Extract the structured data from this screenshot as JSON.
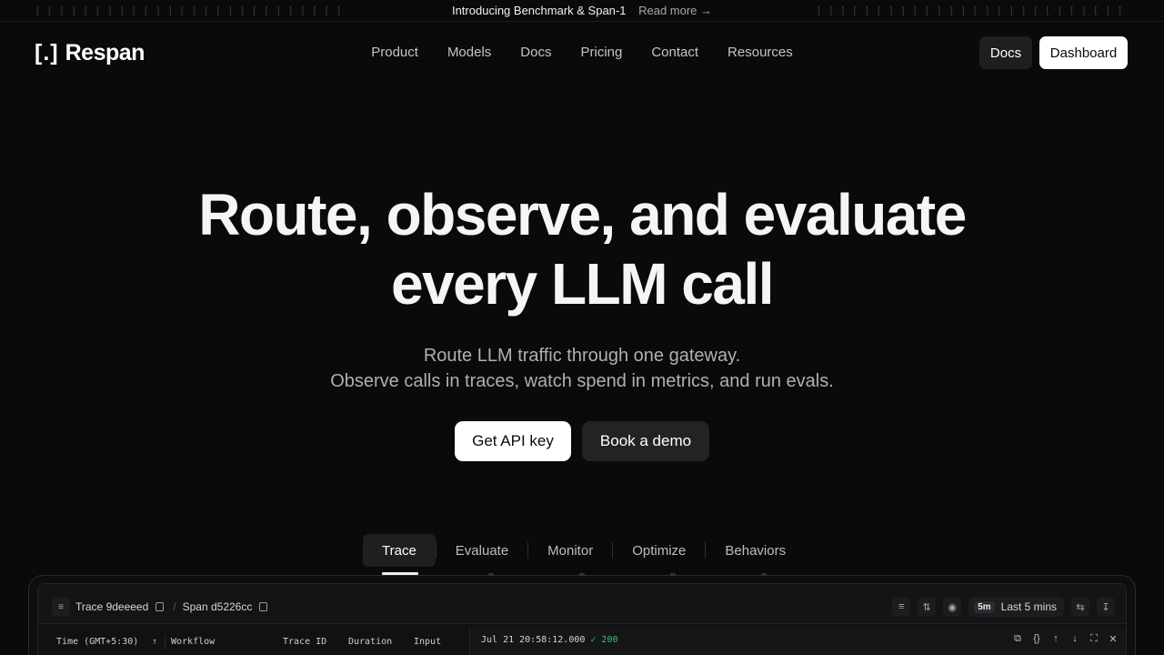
{
  "announcement": {
    "text": "Introducing Benchmark & Span-1",
    "link": "Read more →",
    "left_strip": "[ [ ] ] [ [ ] ] [ [ ] ] [ ] [ [ ] ] [ [ ] ] ] [ [ ] ] ] [ ] [ ] [ [ ] ] [ ] [ [ ] ] [ ] [ [",
    "right_strip": "] ] ] [ ] [ ] ] [ [ ] ] ] [ ] [ ] ] [ [ ] [ ] [ ] ] ] ] [ [ [ ] [ [ [ ] ] [ ] ] ] [ [ [ ["
  },
  "brand": {
    "mark": "[.]",
    "name": "Respan"
  },
  "nav": [
    "Product",
    "Models",
    "Docs",
    "Pricing",
    "Contact",
    "Resources"
  ],
  "header_buttons": {
    "docs": "Docs",
    "dashboard": "Dashboard"
  },
  "hero": {
    "title_line1": "Route, observe, and evaluate",
    "title_line2": "every LLM call",
    "subtitle_line1": "Route LLM traffic through one gateway.",
    "subtitle_line2": "Observe calls in traces, watch spend in metrics, and run evals.",
    "cta_primary": "Get API key",
    "cta_secondary": "Book a demo"
  },
  "tabs": [
    "Trace",
    "Evaluate",
    "Monitor",
    "Optimize",
    "Behaviors"
  ],
  "demo": {
    "trace_label": "Trace 9deeeed",
    "span_label": "Span d5226cc",
    "time_badge": "5m",
    "time_range": "Last 5 mins",
    "columns": [
      "Time (GMT+5:30)",
      "Workflow",
      "Trace ID",
      "Duration",
      "Input"
    ],
    "detail_timestamp": "Jul 21 20:58:12.000",
    "detail_status": "200"
  },
  "colors": {
    "background": "#0a0a0a",
    "accent_green": "#38c172",
    "button_light": "#ffffff",
    "button_dark": "#1f1f22"
  }
}
